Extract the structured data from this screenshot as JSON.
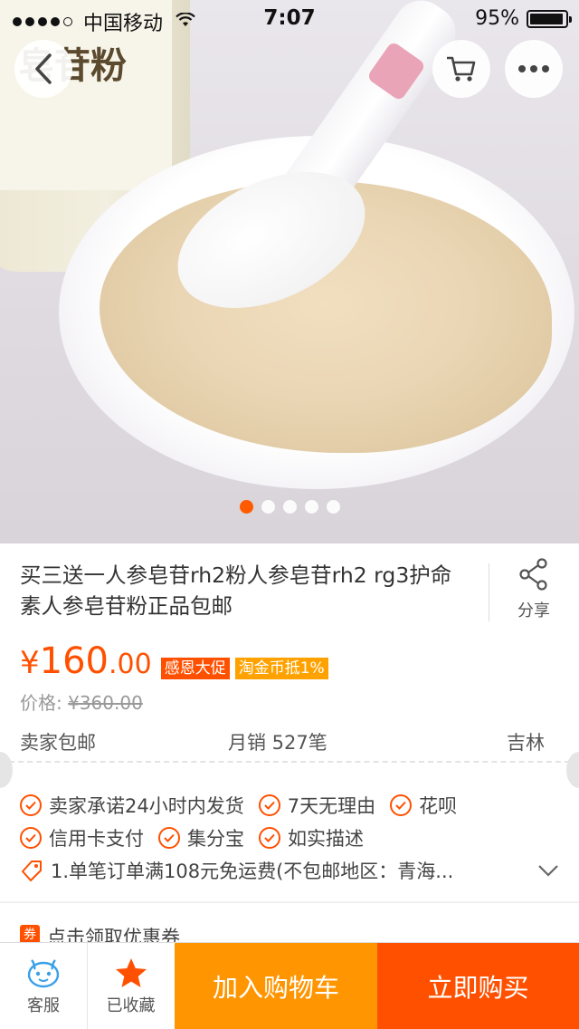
{
  "status_bar": {
    "carrier": "中国移动",
    "time": "7:07",
    "battery": "95%",
    "battery_level": 0.95,
    "signal_bars_filled": 4,
    "signal_bars_total": 5
  },
  "hero": {
    "jar_label_text": "皂苷粉",
    "pager": {
      "count": 5,
      "active_index": 0
    }
  },
  "product": {
    "title": "买三送一人参皂苷rh2粉人参皂苷rh2 rg3护命素人参皂苷粉正品包邮",
    "share_label": "分享",
    "price_currency": "¥",
    "price_int": "160",
    "price_dec": ".00",
    "promo_tags": [
      "感恩大促",
      "淘金币抵1%"
    ],
    "original_price_label": "价格:",
    "original_price": "¥360.00",
    "shipping": "卖家包邮",
    "monthly_sales": "月销 527笔",
    "location": "吉林"
  },
  "services": {
    "line1": [
      "卖家承诺24小时内发货",
      "7天无理由",
      "花呗"
    ],
    "line2": [
      "信用卡支付",
      "集分宝",
      "如实描述"
    ],
    "coupon_text": "1.单笔订单满108元免运费(不包邮地区：青海...",
    "coupon_strip_icon": "券",
    "coupon_strip_label": "点击领取优惠券"
  },
  "bottom_bar": {
    "service_label": "客服",
    "favorite_label": "已收藏",
    "add_cart_label": "加入购物车",
    "buy_now_label": "立即购买"
  },
  "colors": {
    "accent": "#ff5000",
    "add_cart": "#ff9500",
    "tag_orange": "#ffa200",
    "service_blue": "#3aa0e8"
  }
}
